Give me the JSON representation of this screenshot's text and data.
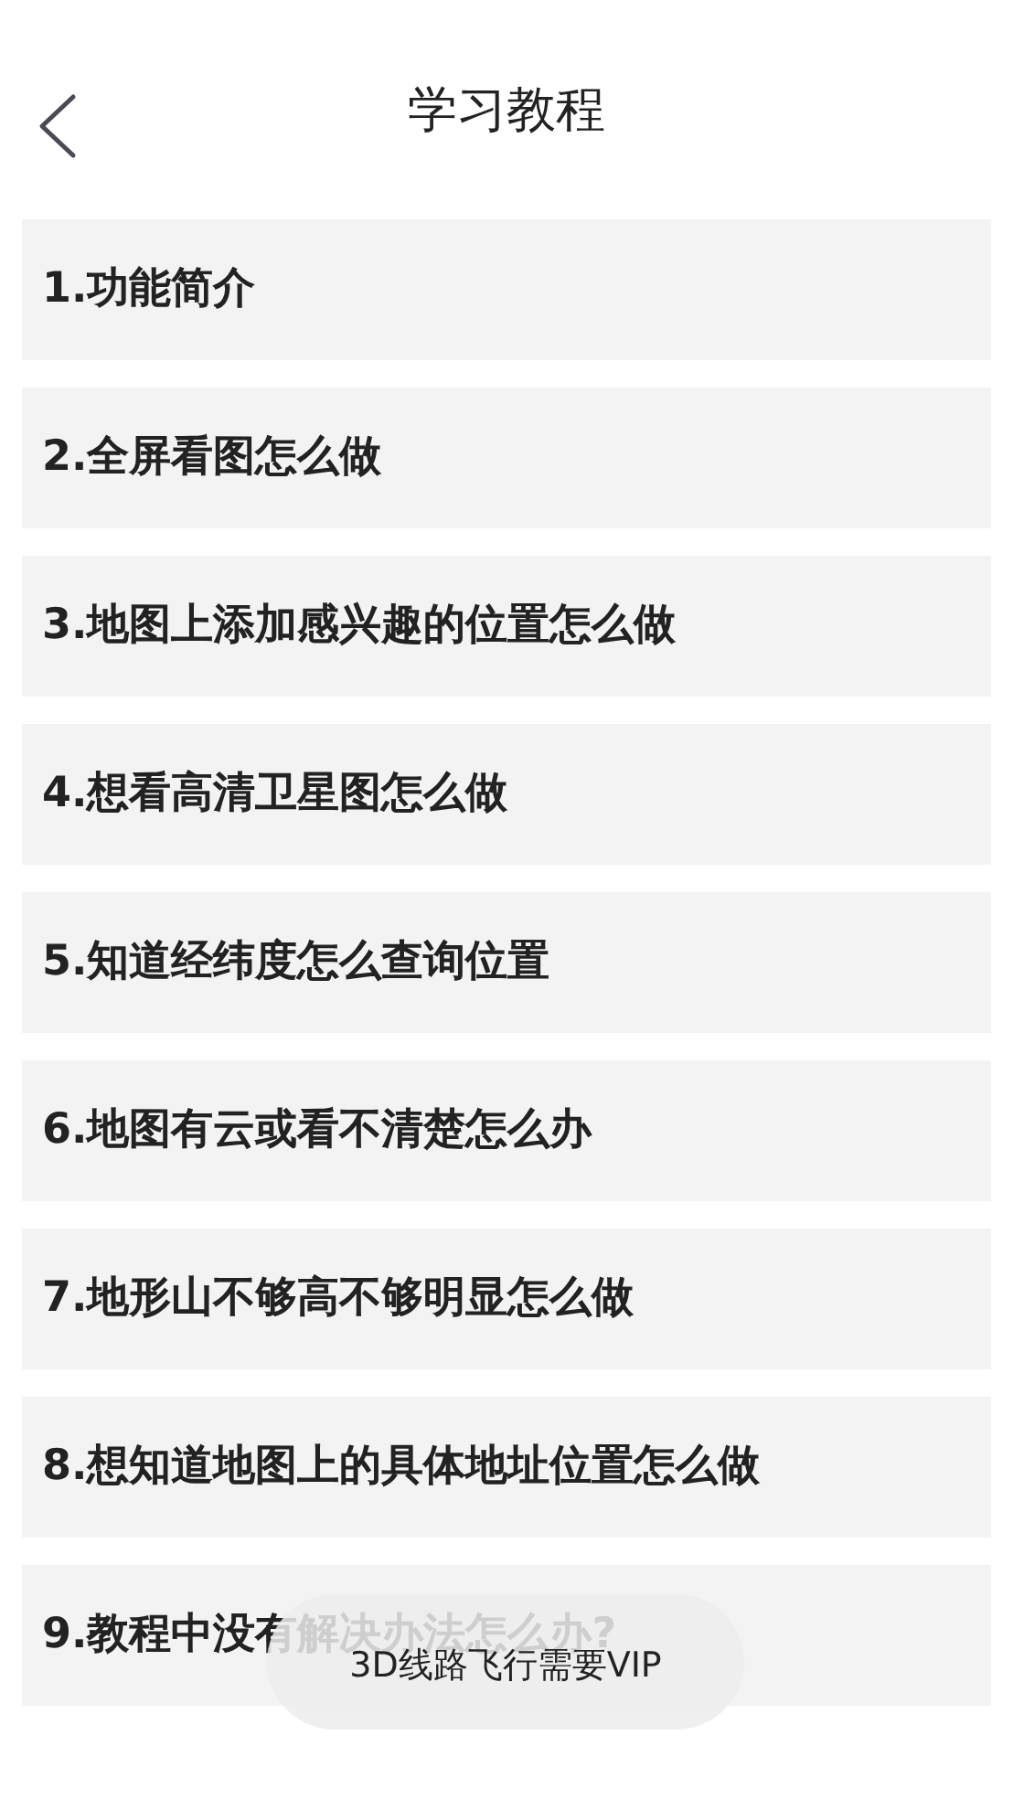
{
  "header": {
    "title": "学习教程"
  },
  "items": [
    {
      "label": "1.功能简介"
    },
    {
      "label": "2.全屏看图怎么做"
    },
    {
      "label": "3.地图上添加感兴趣的位置怎么做"
    },
    {
      "label": "4.想看高清卫星图怎么做"
    },
    {
      "label": "5.知道经纬度怎么查询位置"
    },
    {
      "label": "6.地图有云或看不清楚怎么办"
    },
    {
      "label": "7.地形山不够高不够明显怎么做"
    },
    {
      "label": "8.想知道地图上的具体地址位置怎么做"
    },
    {
      "label": "9.教程中没有解决办法怎么办?"
    }
  ],
  "toast": {
    "text": "3D线路飞行需要VIP"
  }
}
